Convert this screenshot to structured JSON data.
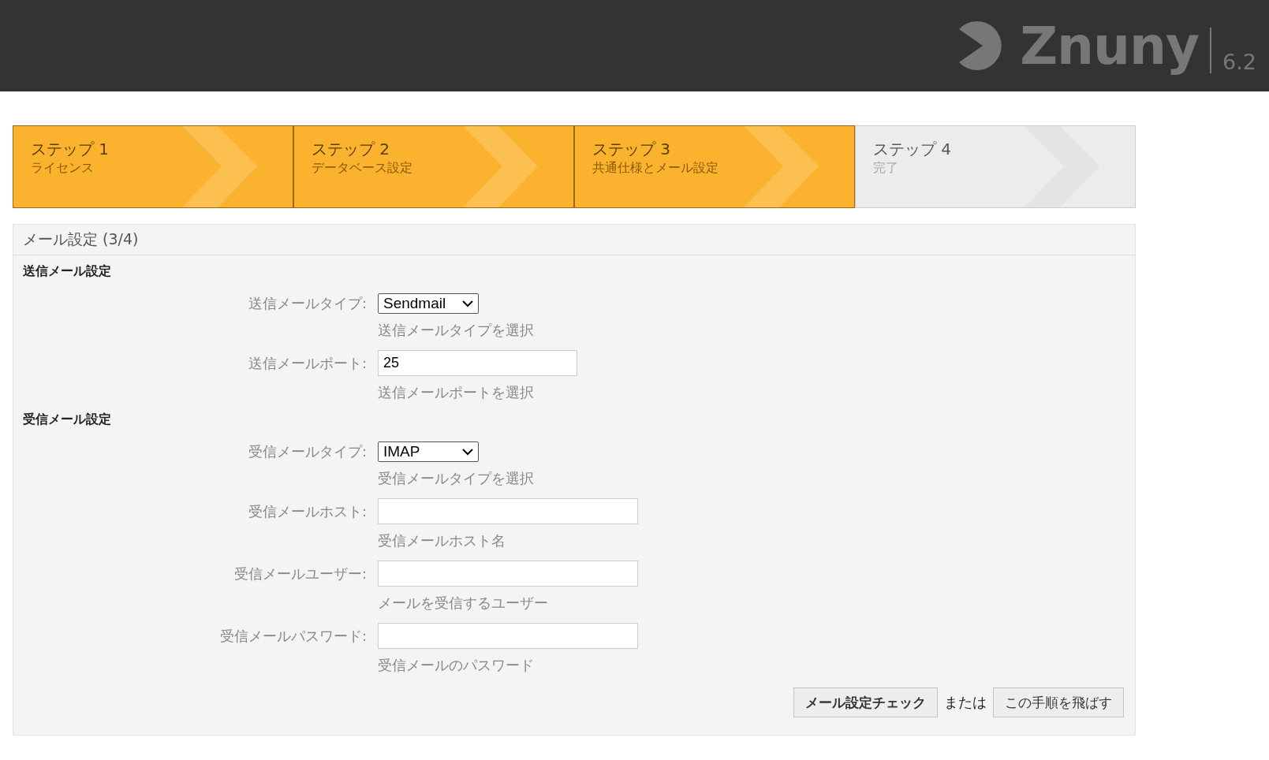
{
  "header": {
    "logo_text": "Znuny",
    "version": "6.2"
  },
  "steps": [
    {
      "title": "ステップ 1",
      "subtitle": "ライセンス",
      "done": true
    },
    {
      "title": "ステップ 2",
      "subtitle": "データベース設定",
      "done": true
    },
    {
      "title": "ステップ 3",
      "subtitle": "共通仕様とメール設定",
      "done": true
    },
    {
      "title": "ステップ 4",
      "subtitle": "完了",
      "done": false
    }
  ],
  "panel": {
    "title": "メール設定 (3/4)",
    "sections": [
      {
        "heading": "送信メール設定",
        "fields": [
          {
            "kind": "select",
            "label": "送信メールタイプ:",
            "value": "Sendmail",
            "hint": "送信メールタイプを選択"
          },
          {
            "kind": "number",
            "label": "送信メールポート:",
            "value": "25",
            "hint": "送信メールポートを選択"
          }
        ]
      },
      {
        "heading": "受信メール設定",
        "fields": [
          {
            "kind": "select",
            "label": "受信メールタイプ:",
            "value": "IMAP",
            "hint": "受信メールタイプを選択"
          },
          {
            "kind": "text",
            "label": "受信メールホスト:",
            "hint": "受信メールホスト名"
          },
          {
            "kind": "text",
            "label": "受信メールユーザー:",
            "hint": "メールを受信するユーザー"
          },
          {
            "kind": "text",
            "label": "受信メールパスワード:",
            "hint": "受信メールのパスワード"
          }
        ]
      }
    ],
    "actions": {
      "primary": "メール設定チェック",
      "separator": "または",
      "secondary": "この手順を飛ばす"
    }
  }
}
